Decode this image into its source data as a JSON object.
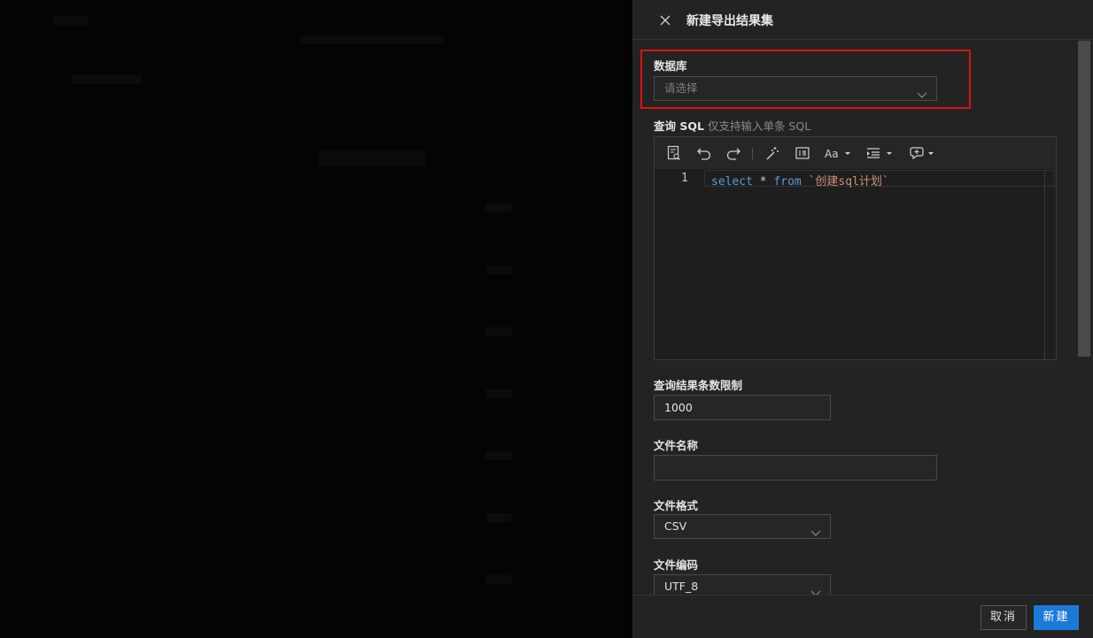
{
  "drawer": {
    "title": "新建导出结果集",
    "close_icon": "close-icon"
  },
  "form": {
    "database": {
      "label": "数据库",
      "placeholder": "请选择"
    },
    "sql": {
      "label": "查询 SQL",
      "hint": "仅支持输入单条 SQL",
      "toolbar_icons": [
        "format-preview-icon",
        "undo-icon",
        "redo-icon",
        "magic-wand-icon",
        "insert-field-icon",
        "font-size-icon",
        "indent-icon",
        "snippet-icon"
      ],
      "line_number": "1",
      "code": {
        "kw1": "select",
        "star": "*",
        "kw2": "from",
        "table": "`创建sql计划`"
      }
    },
    "limit": {
      "label": "查询结果条数限制",
      "value": "1000"
    },
    "file_name": {
      "label": "文件名称",
      "value": ""
    },
    "file_format": {
      "label": "文件格式",
      "value": "CSV"
    },
    "file_encoding": {
      "label": "文件编码",
      "value": "UTF_8"
    }
  },
  "footer": {
    "cancel_label": "取消",
    "create_label": "新建"
  },
  "colors": {
    "highlight": "#dd1111",
    "primary": "#1b7ad8",
    "drawer_bg": "#232323"
  }
}
